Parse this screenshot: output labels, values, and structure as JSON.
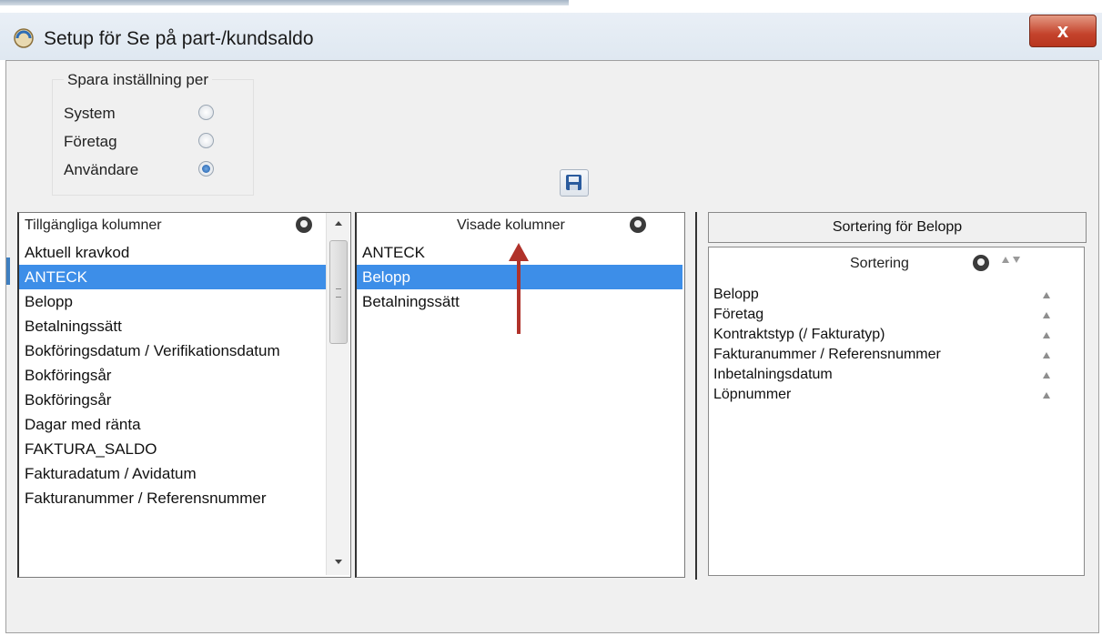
{
  "window": {
    "title": "Setup för Se på part-/kundsaldo",
    "close_label": "x"
  },
  "save_settings": {
    "group_label": "Spara inställning per",
    "options": [
      {
        "label": "System",
        "checked": false
      },
      {
        "label": "Företag",
        "checked": false
      },
      {
        "label": "Användare",
        "checked": true
      }
    ]
  },
  "available_columns": {
    "header": "Tillgängliga kolumner",
    "items": [
      "Aktuell kravkod",
      "ANTECK",
      "Belopp",
      "Betalningssätt",
      "Bokföringsdatum / Verifikationsdatum",
      "Bokföringsår",
      "Bokföringsår",
      "Dagar med ränta",
      "FAKTURA_SALDO",
      "Fakturadatum / Avidatum",
      "Fakturanummer / Referensnummer"
    ],
    "selected_index": 1
  },
  "shown_columns": {
    "header": "Visade kolumner",
    "items": [
      "ANTECK",
      "Belopp",
      "Betalningssätt"
    ],
    "selected_index": 1
  },
  "sorting": {
    "tab_label": "Sortering för Belopp",
    "header": "Sortering",
    "items": [
      "Belopp",
      "Företag",
      "Kontraktstyp (/ Fakturatyp)",
      "Fakturanummer / Referensnummer",
      "Inbetalningsdatum",
      "Löpnummer"
    ]
  },
  "colors": {
    "selection": "#3d8ee8",
    "close_button": "#c4432c",
    "annotation_arrow": "#b0322a"
  }
}
